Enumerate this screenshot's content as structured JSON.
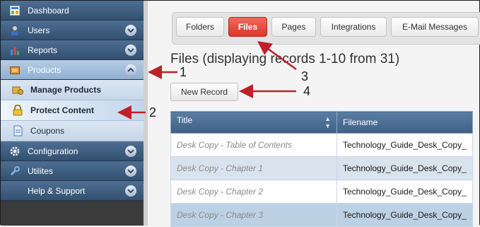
{
  "sidebar": {
    "items": [
      {
        "label": "Dashboard",
        "icon": "dashboard-icon"
      },
      {
        "label": "Users",
        "icon": "users-icon"
      },
      {
        "label": "Reports",
        "icon": "reports-icon"
      },
      {
        "label": "Products",
        "icon": "products-icon"
      },
      {
        "label": "Configuration",
        "icon": "gear-icon"
      },
      {
        "label": "Utilites",
        "icon": "wrench-icon"
      },
      {
        "label": "Help & Support"
      }
    ],
    "sub_items": [
      {
        "label": "Manage Products",
        "icon": "manage-products-icon"
      },
      {
        "label": "Protect Content",
        "icon": "lock-icon"
      },
      {
        "label": "Coupons",
        "icon": "coupon-icon"
      }
    ]
  },
  "tabs": [
    "Folders",
    "Files",
    "Pages",
    "Integrations",
    "E-Mail Messages"
  ],
  "active_tab": "Files",
  "page_title": "Files (displaying records 1-10 from 31)",
  "new_record_label": "New Record",
  "table": {
    "columns": [
      "Title",
      "Filename"
    ],
    "rows": [
      {
        "title": "Desk Copy - Table of Contents",
        "filename": "Technology_Guide_Desk_Copy_"
      },
      {
        "title": "Desk Copy - Chapter 1",
        "filename": "Technology_Guide_Desk_Copy_"
      },
      {
        "title": "Desk Copy - Chapter 2",
        "filename": "Technology_Guide_Desk_Copy_"
      },
      {
        "title": "Desk Copy - Chapter 3",
        "filename": "Technology_Guide_Desk_Copy_"
      }
    ]
  },
  "annotations": [
    "1",
    "2",
    "3",
    "4"
  ],
  "colors": {
    "arrow": "#c0202a",
    "active_tab": "#d8382a",
    "nav": "#3f6185"
  }
}
